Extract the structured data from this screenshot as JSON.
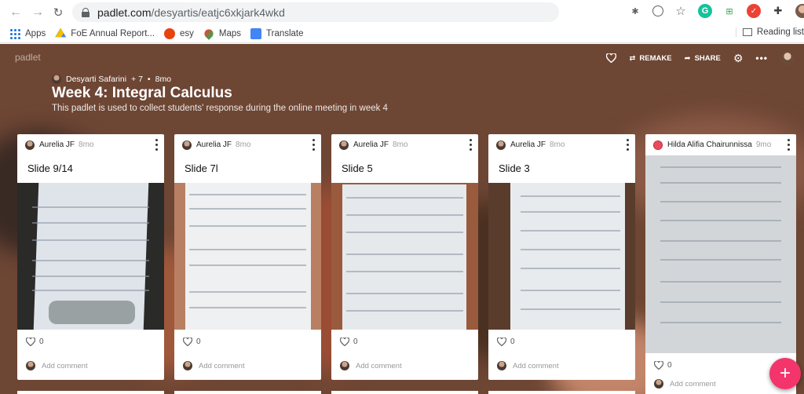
{
  "browser": {
    "url_host": "padlet.com",
    "url_path": "/desyartis/eatjc6xkjark4wkd"
  },
  "bookmarks": [
    {
      "label": "Apps",
      "icon": "apps-grid-icon"
    },
    {
      "label": "FoE Annual Report...",
      "icon": "drive-icon"
    },
    {
      "label": "esy",
      "icon": "esy-icon"
    },
    {
      "label": "Maps",
      "icon": "maps-pin-icon"
    },
    {
      "label": "Translate",
      "icon": "translate-icon"
    }
  ],
  "reading_list": "Reading list",
  "padlet": {
    "brand": "padlet",
    "actions": {
      "remake": "REMAKE",
      "share": "SHARE"
    },
    "author": "Desyarti Safarini",
    "plus": "+ 7",
    "separator": "•",
    "age": "8mo",
    "title": "Week 4: Integral Calculus",
    "subtitle": "This padlet is used to collect students' response during the online meeting in week 4"
  },
  "cards": [
    {
      "author": "Aurelia JF",
      "time": "8mo",
      "title": "Slide 9/14",
      "likes": "0",
      "comment_placeholder": "Add comment"
    },
    {
      "author": "Aurelia JF",
      "time": "8mo",
      "title": "Slide 7l",
      "likes": "0",
      "comment_placeholder": "Add comment"
    },
    {
      "author": "Aurelia JF",
      "time": "8mo",
      "title": "Slide 5",
      "likes": "0",
      "comment_placeholder": "Add comment"
    },
    {
      "author": "Aurelia JF",
      "time": "8mo",
      "title": "Slide 3",
      "likes": "0",
      "comment_placeholder": "Add comment"
    },
    {
      "author": "Hilda Alifia Chairunnissa",
      "time": "9mo",
      "title": "",
      "likes": "0",
      "comment_placeholder": "Add comment"
    }
  ],
  "fab": "+",
  "colors": {
    "header_bg": "#6e4634",
    "fab": "#f3356c"
  }
}
